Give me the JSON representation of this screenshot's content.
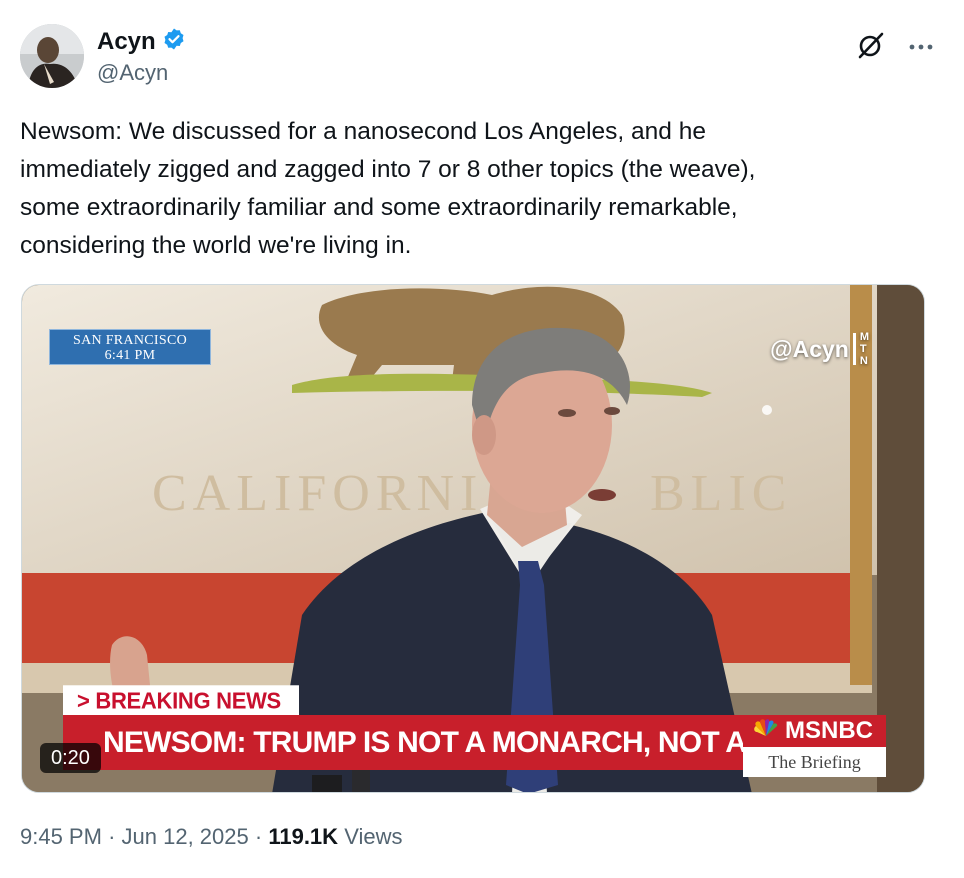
{
  "author": {
    "display_name": "Acyn",
    "handle": "@Acyn",
    "verified": true,
    "verified_color": "#1d9bf0"
  },
  "header_icons": [
    "grok-icon",
    "more-icon"
  ],
  "tweet": {
    "text": "Newsom: We discussed for a nanosecond Los Angeles, and he\nimmediately zigged and zagged into 7 or 8 other topics (the weave),\nsome extraordinarily familiar and some extraordinarily remarkable,\nconsidering the world we're living in."
  },
  "video": {
    "location_line1": "SAN FRANCISCO",
    "location_line2": "6:41 PM",
    "watermark": "@Acyn",
    "watermark_logo": [
      "M",
      "T",
      "N"
    ],
    "breaking_label": "> BREAKING NEWS",
    "headline": "NEWSOM: TRUMP IS NOT A MONARCH, NOT A KING",
    "network": "MSNBC",
    "show": "The Briefing",
    "timer": "0:20",
    "flag_text_left": "CALIFORNIA",
    "flag_text_right": "BLIC"
  },
  "footer": {
    "time": "9:45 PM",
    "separator": "·",
    "date": "Jun 12, 2025",
    "views_count": "119.1K",
    "views_label": "Views"
  },
  "colors": {
    "text_primary": "#0f1419",
    "text_secondary": "#536471",
    "chyron_red": "#c81f2b",
    "location_blue": "#2f6fb0"
  }
}
